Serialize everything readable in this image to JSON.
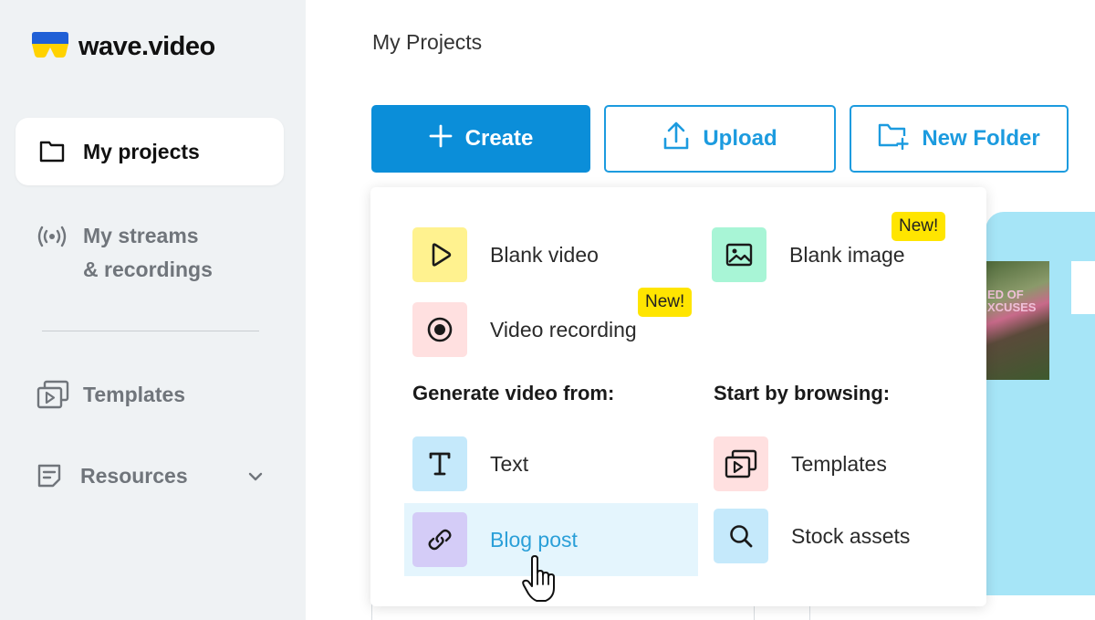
{
  "app": {
    "name": "wave.video"
  },
  "sidebar": {
    "items": [
      {
        "label": "My projects",
        "icon": "folder-icon",
        "active": true
      },
      {
        "label_line1": "My streams",
        "label_line2": "& recordings",
        "icon": "broadcast-icon"
      },
      {
        "label": "Templates",
        "icon": "templates-icon"
      },
      {
        "label": "Resources",
        "icon": "document-icon",
        "expand_icon": "chevron-down-icon"
      }
    ]
  },
  "main": {
    "title": "My Projects",
    "buttons": {
      "create": "Create",
      "upload": "Upload",
      "new_folder": "New Folder"
    }
  },
  "dropdown": {
    "items": {
      "blank_video": {
        "label": "Blank video",
        "icon": "play-icon",
        "color": "#fff28f"
      },
      "blank_image": {
        "label": "Blank image",
        "icon": "image-icon",
        "color": "#a8f5d6",
        "badge": "New!"
      },
      "video_recording": {
        "label": "Video recording",
        "icon": "record-icon",
        "color": "#ffe0e0",
        "badge": "New!"
      },
      "text": {
        "label": "Text",
        "icon": "text-icon",
        "color": "#c5e9fb"
      },
      "blog_post": {
        "label": "Blog post",
        "icon": "link-icon",
        "color": "#d4ccf7",
        "hovered": true
      },
      "templates": {
        "label": "Templates",
        "icon": "templates-icon",
        "color": "#ffe0e0"
      },
      "stock_assets": {
        "label": "Stock assets",
        "icon": "search-icon",
        "color": "#c5e9fb"
      }
    },
    "sections": {
      "generate": "Generate video from:",
      "browse": "Start by browsing:"
    }
  },
  "background": {
    "thumbnail_text": "ED OF\nXCUSES"
  },
  "colors": {
    "accent": "#0b8ed9",
    "outline": "#1c9bdf",
    "badge": "#ffe500",
    "hover": "#e4f5fd",
    "hover_text": "#2a9fd8"
  }
}
